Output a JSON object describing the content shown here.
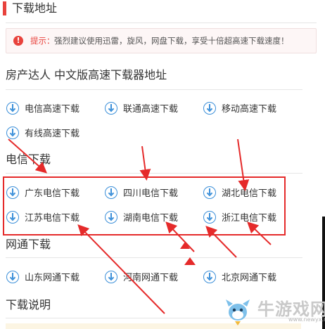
{
  "header": {
    "title": "下载地址"
  },
  "tip": {
    "icon": "alert-icon",
    "label": "提示：",
    "text": "强烈建议使用迅雷，旋风，网盘下载，享受十倍超高速下载速度！"
  },
  "sections": [
    {
      "title": "房产达人 中文版高速下载器地址",
      "links": [
        "电信高速下载",
        "联通高速下载",
        "移动高速下载",
        "有线高速下载"
      ]
    },
    {
      "title": "电信下载",
      "links": [
        "广东电信下载",
        "四川电信下载",
        "湖北电信下载",
        "江苏电信下载",
        "湖南电信下载",
        "浙江电信下载"
      ]
    },
    {
      "title": "网通下载",
      "links": [
        "山东网通下载",
        "河南网通下载",
        "北京网通下载"
      ]
    },
    {
      "title": "下载说明",
      "links": []
    }
  ],
  "watermark": {
    "text": "牛游戏网",
    "url": "www.newyx.net"
  },
  "colors": {
    "accent": "#e8423c",
    "icon_blue": "#3b8fd9",
    "annotation_red": "#e52a2a"
  }
}
